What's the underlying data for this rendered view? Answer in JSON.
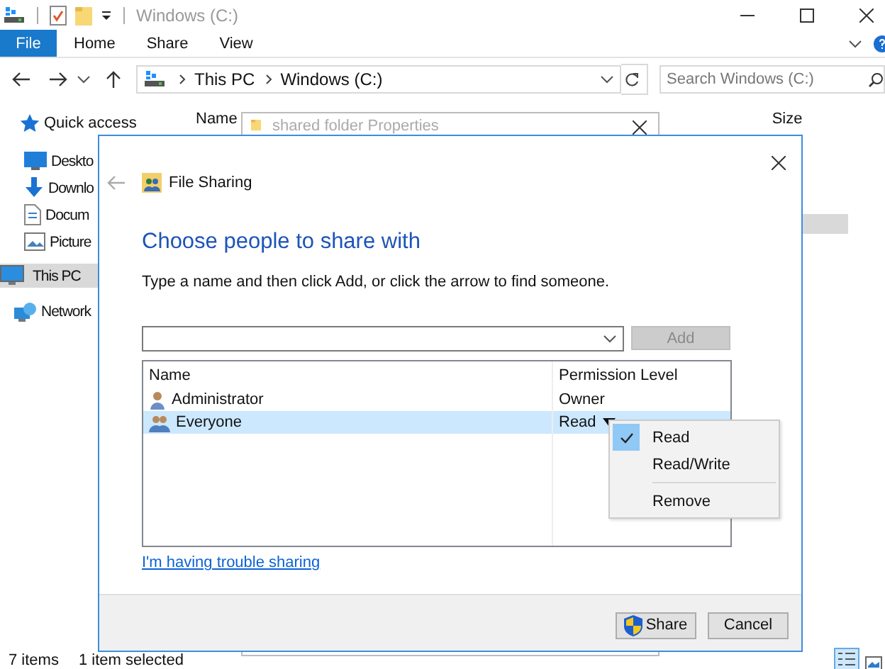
{
  "explorer": {
    "title": "Windows (C:)",
    "file_tab": "File",
    "ribbon_tabs": [
      "Home",
      "Share",
      "View"
    ],
    "address": {
      "path": [
        "This PC",
        "Windows (C:)"
      ]
    },
    "search": {
      "placeholder": "Search Windows (C:)"
    },
    "columns": [
      "Name",
      "Size"
    ],
    "sidebar": {
      "items": [
        {
          "label": "Quick access",
          "kind": "star",
          "selected": false
        },
        {
          "label": "Deskto",
          "kind": "desktop",
          "selected": false
        },
        {
          "label": "Downlo",
          "kind": "download",
          "selected": false
        },
        {
          "label": "Docum",
          "kind": "document",
          "selected": false
        },
        {
          "label": "Picture",
          "kind": "pictures",
          "selected": false
        },
        {
          "label": "This PC",
          "kind": "pc",
          "selected": true
        },
        {
          "label": "Network",
          "kind": "network",
          "selected": false
        }
      ]
    },
    "status_bar": {
      "items": [
        "7 items",
        "1 item selected"
      ]
    }
  },
  "behind_window": {
    "title": "shared folder Properties"
  },
  "dialog": {
    "title": "File Sharing",
    "heading": "Choose people to share with",
    "instruction": "Type a name and then click Add, or click the arrow to find someone.",
    "add_button": {
      "label": "Add",
      "disabled": true
    },
    "list": {
      "columns": [
        "Name",
        "Permission Level"
      ],
      "rows": [
        {
          "name": "Administrator",
          "permission": "Owner",
          "kind": "user",
          "selected": false,
          "dropdown": false
        },
        {
          "name": "Everyone",
          "permission": "Read",
          "kind": "group",
          "selected": true,
          "dropdown": true
        }
      ]
    },
    "link": "I'm having trouble sharing",
    "buttons": [
      {
        "label": "Share",
        "kind": "shield"
      },
      {
        "label": "Cancel",
        "kind": "plain"
      }
    ]
  },
  "menu": {
    "items": [
      {
        "kind": "option",
        "label": "Read",
        "checked": true
      },
      {
        "kind": "option",
        "label": "Read/Write",
        "checked": false
      },
      {
        "kind": "separator"
      },
      {
        "kind": "option",
        "label": "Remove",
        "checked": false
      }
    ]
  }
}
